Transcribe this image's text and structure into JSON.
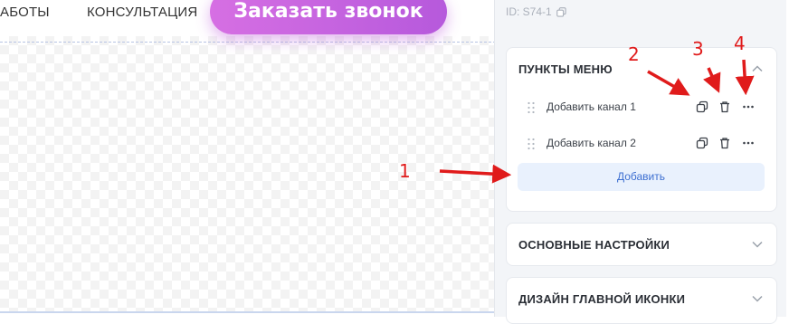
{
  "site_header": {
    "nav_links": [
      "АБОТЫ",
      "КОНСУЛЬТАЦИЯ"
    ],
    "cta_button": "Заказать звонок"
  },
  "panel": {
    "id_label": "ID: S74-1",
    "menu_section": {
      "title": "ПУНКТЫ МЕНЮ",
      "items": [
        {
          "label": "Добавить канал 1"
        },
        {
          "label": "Добавить канал 2"
        }
      ],
      "add_button": "Добавить"
    },
    "basic_section": {
      "title": "ОСНОВНЫЕ НАСТРОЙКИ"
    },
    "design_section": {
      "title": "ДИЗАЙН ГЛАВНОЙ ИКОНКИ"
    }
  },
  "annotations": [
    "1",
    "2",
    "3",
    "4"
  ],
  "colors": {
    "accent": "#3d6fd1",
    "annotation": "#e01b1b",
    "cta": "#c464df"
  },
  "icons": [
    "copy-icon",
    "trash-icon",
    "more-icon",
    "drag-handle-icon",
    "chevron-up-icon",
    "chevron-down-icon"
  ]
}
